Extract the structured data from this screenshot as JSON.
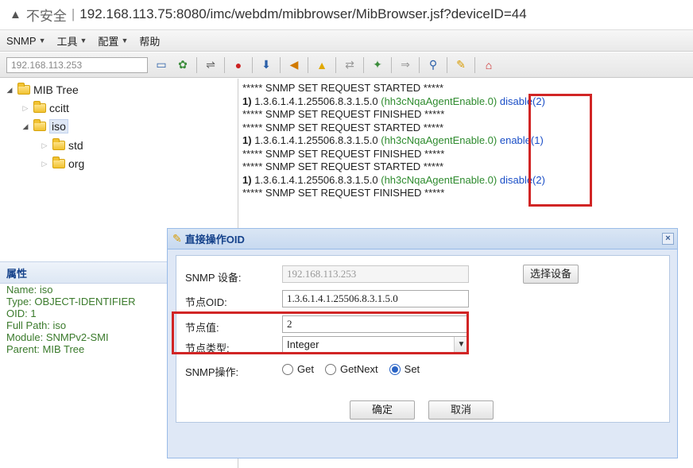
{
  "browser": {
    "warning_icon": "warning-triangle-icon",
    "insecure": "不安全",
    "separator": "|",
    "url": "192.168.113.75:8080/imc/webdm/mibbrowser/MibBrowser.jsf?deviceID=44"
  },
  "menubar": {
    "items": [
      {
        "label": "SNMP",
        "has_caret": true
      },
      {
        "label": "工具",
        "has_caret": true
      },
      {
        "label": "配置",
        "has_caret": true
      },
      {
        "label": "帮助",
        "has_caret": false
      }
    ]
  },
  "toolbar": {
    "ip_value": "192.168.113.253"
  },
  "tree": {
    "root": "MIB Tree",
    "ccitt": "ccitt",
    "iso": "iso",
    "std": "std",
    "org": "org"
  },
  "props": {
    "header": "属性",
    "name": "Name: iso",
    "type": "Type: OBJECT-IDENTIFIER",
    "oid": "OID: 1",
    "fullpath": "Full Path: iso",
    "module": "Module: SNMPv2-SMI",
    "parent": "Parent: MIB Tree"
  },
  "log": {
    "started": "***** SNMP SET REQUEST STARTED *****",
    "finished": "***** SNMP SET REQUEST FINISHED *****",
    "entries": [
      {
        "num": "1)",
        "oid": "1.3.6.1.4.1.25506.8.3.1.5.0",
        "name": "(hh3cNqaAgentEnable.0)",
        "value": "disable(2)"
      },
      {
        "num": "1)",
        "oid": "1.3.6.1.4.1.25506.8.3.1.5.0",
        "name": "(hh3cNqaAgentEnable.0)",
        "value": "enable(1)"
      },
      {
        "num": "1)",
        "oid": "1.3.6.1.4.1.25506.8.3.1.5.0",
        "name": "(hh3cNqaAgentEnable.0)",
        "value": "disable(2)"
      }
    ]
  },
  "dialog": {
    "title": "直接操作OID",
    "close": "×",
    "device_label": "SNMP 设备:",
    "device_value": "192.168.113.253",
    "select_device_btn": "选择设备",
    "oid_label": "节点OID:",
    "oid_value": "1.3.6.1.4.1.25506.8.3.1.5.0",
    "value_label": "节点值:",
    "value_value": "2",
    "type_label": "节点类型:",
    "type_value": "Integer",
    "op_label": "SNMP操作:",
    "op_get": "Get",
    "op_getnext": "GetNext",
    "op_set": "Set",
    "op_selected": "Set",
    "ok_btn": "确定",
    "cancel_btn": "取消"
  },
  "colors": {
    "highlight": "#d12525",
    "oid_name": "#2e8b2e",
    "value": "#1a4ec7",
    "props_text": "#3a7a2b"
  }
}
